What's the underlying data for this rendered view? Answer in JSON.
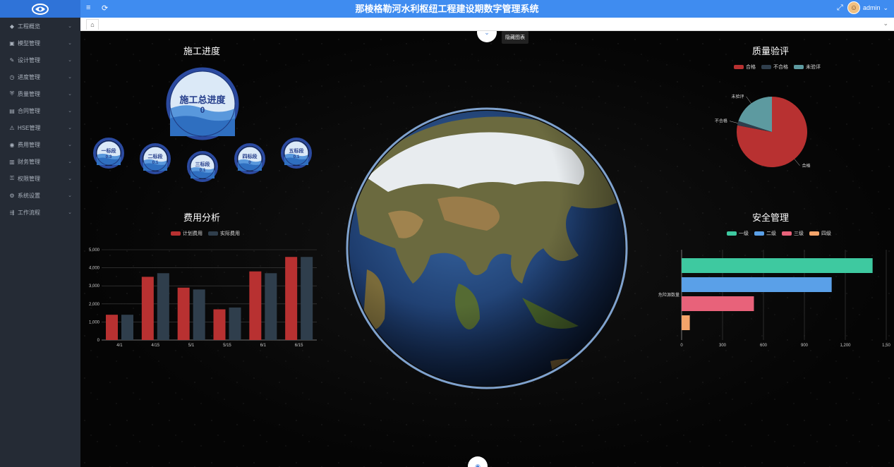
{
  "app": {
    "title": "那棱格勒河水利枢纽工程建设期数字管理系统",
    "user": "admin"
  },
  "sidebar": {
    "items": [
      {
        "label": "工程概览",
        "icon": "diamond-icon"
      },
      {
        "label": "模型管理",
        "icon": "cube-icon"
      },
      {
        "label": "设计管理",
        "icon": "design-icon"
      },
      {
        "label": "进度管理",
        "icon": "clock-icon"
      },
      {
        "label": "质量管理",
        "icon": "shield-icon"
      },
      {
        "label": "合同管理",
        "icon": "document-icon"
      },
      {
        "label": "HSE管理",
        "icon": "safety-icon"
      },
      {
        "label": "费用管理",
        "icon": "coin-icon"
      },
      {
        "label": "财务管理",
        "icon": "wallet-icon"
      },
      {
        "label": "权限管理",
        "icon": "lock-icon"
      },
      {
        "label": "系统设置",
        "icon": "gear-icon"
      },
      {
        "label": "工作流程",
        "icon": "flow-icon"
      }
    ]
  },
  "overlay": {
    "hide_charts_label": "隐藏图表"
  },
  "progress": {
    "title": "施工总进度",
    "panel_title": "施工进度",
    "total": {
      "label": "施工总进度",
      "value": "0"
    },
    "sections": [
      {
        "label": "一标段",
        "value": "0.3"
      },
      {
        "label": "二标段",
        "value": "0.1"
      },
      {
        "label": "三标段",
        "value": "0.1"
      },
      {
        "label": "四标段",
        "value": "0"
      },
      {
        "label": "五标段",
        "value": "0.1"
      }
    ]
  },
  "cost": {
    "panel_title": "费用分析"
  },
  "quality": {
    "panel_title": "质量验评"
  },
  "safety": {
    "panel_title": "安全管理"
  },
  "colors": {
    "red": "#b83131",
    "slate": "#2f3e4c",
    "teal": "#5d9aa0",
    "green": "#3ec9a0",
    "blue": "#5aa0e8",
    "pink": "#e8627a",
    "orange": "#f4a46a"
  },
  "chart_data": [
    {
      "type": "bar",
      "title": "费用分析",
      "categories": [
        "4/1",
        "4/15",
        "5/1",
        "5/15",
        "6/1",
        "6/15"
      ],
      "series": [
        {
          "name": "计划费用",
          "values": [
            1400,
            3500,
            2900,
            1700,
            3800,
            4600
          ]
        },
        {
          "name": "实际费用",
          "values": [
            1400,
            3700,
            2800,
            1800,
            3700,
            4600
          ]
        }
      ],
      "ylim": [
        0,
        5000
      ],
      "yticks": [
        "0",
        "1,000",
        "2,000",
        "3,000",
        "4,000",
        "5,000"
      ],
      "grid": true,
      "legend": "top"
    },
    {
      "type": "pie",
      "title": "质量验评",
      "labels": [
        "合格",
        "不合格",
        "未验评"
      ],
      "values": [
        78,
        2,
        20
      ],
      "legend": "top"
    },
    {
      "type": "bar",
      "orientation": "horizontal",
      "title": "安全管理",
      "categories": [
        "危险源数量"
      ],
      "series": [
        {
          "name": "一级",
          "values": [
            1400
          ]
        },
        {
          "name": "二级",
          "values": [
            1100
          ]
        },
        {
          "name": "三级",
          "values": [
            530
          ]
        },
        {
          "name": "四级",
          "values": [
            60
          ]
        }
      ],
      "xlim": [
        0,
        1500
      ],
      "xticks": [
        "0",
        "300",
        "600",
        "900",
        "1,200",
        "1,50"
      ],
      "grid": true,
      "legend": "top"
    }
  ]
}
